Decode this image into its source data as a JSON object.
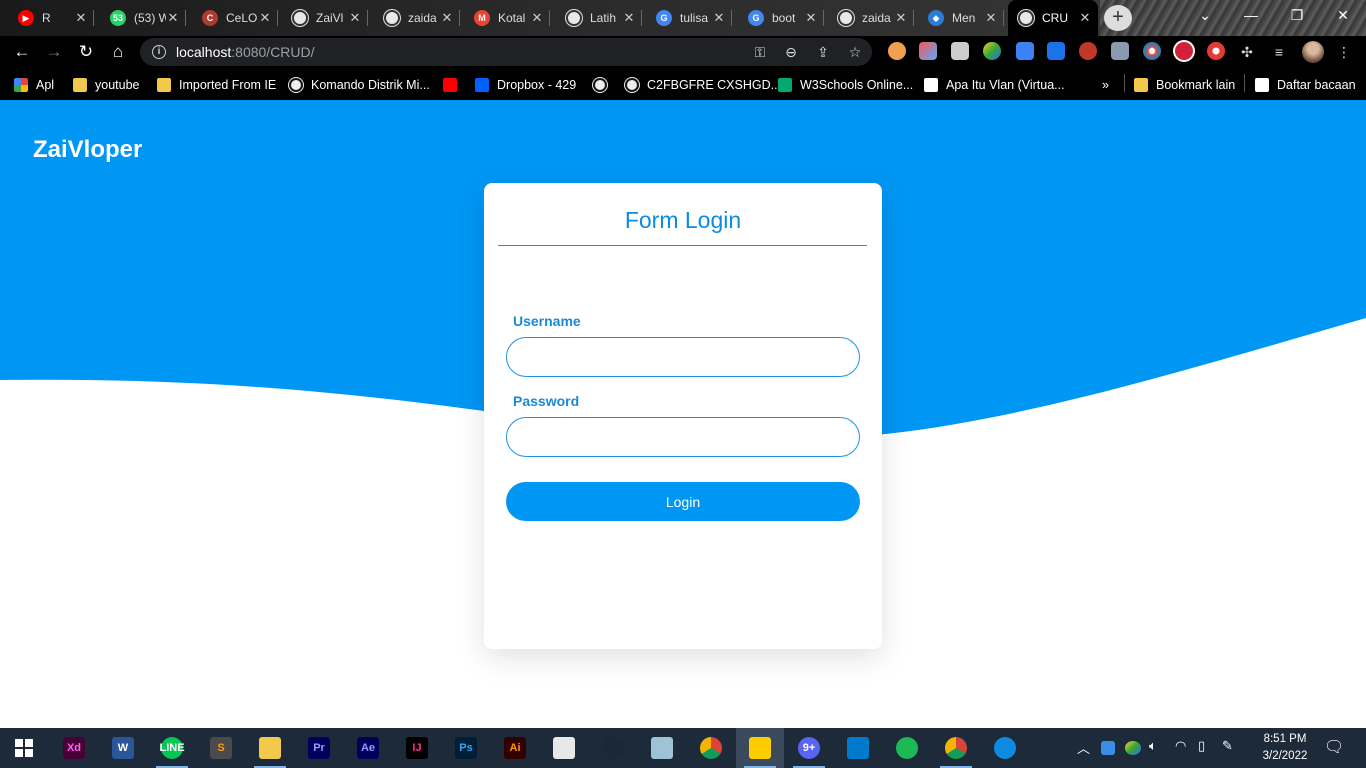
{
  "browser": {
    "tabs": [
      {
        "title": "R",
        "icon": "youtube-icon",
        "color": "#ff0000",
        "glyph": "▶"
      },
      {
        "title": "(53) W",
        "icon": "whatsapp-icon",
        "color": "#25d366",
        "glyph": "53"
      },
      {
        "title": "CeLO",
        "icon": "celo-icon",
        "color": "#b03a2e",
        "glyph": "C"
      },
      {
        "title": "ZaiVl",
        "icon": "globe-icon",
        "color": "#e8e8e8",
        "glyph": ""
      },
      {
        "title": "zaida",
        "icon": "github-icon",
        "color": "#e8e8e8",
        "glyph": ""
      },
      {
        "title": "Kotal",
        "icon": "gmail-icon",
        "color": "#ea4335",
        "glyph": "M"
      },
      {
        "title": "Latih",
        "icon": "globe-icon",
        "color": "#e8e8e8",
        "glyph": ""
      },
      {
        "title": "tulisa",
        "icon": "google-icon",
        "color": "#4285f4",
        "glyph": "G"
      },
      {
        "title": "boot",
        "icon": "google-icon",
        "color": "#4285f4",
        "glyph": "G"
      },
      {
        "title": "zaida",
        "icon": "github-icon",
        "color": "#e8e8e8",
        "glyph": ""
      },
      {
        "title": "Men",
        "icon": "diamond-icon",
        "color": "#2b7cd3",
        "glyph": "◆"
      },
      {
        "title": "CRU",
        "icon": "globe-icon",
        "color": "#e8e8e8",
        "glyph": ""
      }
    ],
    "new_tab": "+",
    "address": {
      "host": "localhost",
      "path": ":8080/CRUD/"
    },
    "bookmarks": [
      {
        "label": "Apl",
        "icon": "apps-grid-icon",
        "color": "#4a90d9"
      },
      {
        "label": "youtube",
        "icon": "folder-icon",
        "color": "#f2c94c"
      },
      {
        "label": "Imported From IE",
        "icon": "folder-icon",
        "color": "#f2c94c"
      },
      {
        "label": "Komando Distrik Mi...",
        "icon": "globe-icon",
        "color": "#eeeeee"
      },
      {
        "label": "",
        "icon": "youtube-icon",
        "color": "#ff0000"
      },
      {
        "label": "Dropbox - 429",
        "icon": "dropbox-icon",
        "color": "#0061fe"
      },
      {
        "label": "",
        "icon": "globe-icon",
        "color": "#eeeeee"
      },
      {
        "label": "C2FBGFRE CXSHGD...",
        "icon": "globe-icon",
        "color": "#eeeeee"
      },
      {
        "label": "W3Schools Online...",
        "icon": "w3schools-icon",
        "color": "#04aa6d"
      },
      {
        "label": "Apa Itu Vlan (Virtua...",
        "icon": "wordpress-icon",
        "color": "#ffffff"
      },
      {
        "label": "»",
        "icon": "",
        "color": ""
      },
      {
        "label": "Bookmark lain",
        "icon": "folder-icon",
        "color": "#f2c94c"
      },
      {
        "label": "Daftar bacaan",
        "icon": "reading-list-icon",
        "color": "#ffffff"
      }
    ]
  },
  "page": {
    "brand": "ZaiVloper",
    "colors": {
      "primary": "#0096f4",
      "title": "#0c8ce0"
    },
    "form": {
      "title": "Form Login",
      "username_label": "Username",
      "username_value": "",
      "password_label": "Password",
      "password_value": "",
      "submit_label": "Login"
    }
  },
  "taskbar": {
    "apps": [
      {
        "name": "Xd",
        "icon": "adobe-xd-icon",
        "color": "#470137",
        "fg": "#ff61f6",
        "running": false
      },
      {
        "name": "W",
        "icon": "word-icon",
        "color": "#2b579a",
        "fg": "#ffffff",
        "running": false
      },
      {
        "name": "LINE",
        "icon": "line-icon",
        "color": "#06c755",
        "fg": "#ffffff",
        "running": true
      },
      {
        "name": "S",
        "icon": "sublime-icon",
        "color": "#4b4b4b",
        "fg": "#ff9800",
        "running": false
      },
      {
        "name": "",
        "icon": "file-explorer-icon",
        "color": "#f2c94c",
        "fg": "#ffffff",
        "running": true
      },
      {
        "name": "Pr",
        "icon": "premiere-icon",
        "color": "#00005b",
        "fg": "#9999ff",
        "running": false
      },
      {
        "name": "Ae",
        "icon": "after-effects-icon",
        "color": "#00005b",
        "fg": "#9999ff",
        "running": false
      },
      {
        "name": "IJ",
        "icon": "intellij-icon",
        "color": "#000000",
        "fg": "#ff318c",
        "running": false
      },
      {
        "name": "Ps",
        "icon": "photoshop-icon",
        "color": "#001e36",
        "fg": "#31a8ff",
        "running": false
      },
      {
        "name": "Ai",
        "icon": "illustrator-icon",
        "color": "#330000",
        "fg": "#ff9a00",
        "running": false
      },
      {
        "name": "",
        "icon": "spreadsheet-icon",
        "color": "#e8e8e8",
        "fg": "#2e7d32",
        "running": false
      },
      {
        "name": "",
        "icon": "steam-icon",
        "color": "#1b2838",
        "fg": "#ffffff",
        "running": false
      },
      {
        "name": "",
        "icon": "notepad-icon",
        "color": "#9ec3d6",
        "fg": "#ffffff",
        "running": false
      },
      {
        "name": "",
        "icon": "chrome-icon",
        "color": "#db4437",
        "fg": "#ffffff",
        "running": false
      },
      {
        "name": "",
        "icon": "sticky-notes-icon",
        "color": "#ffcc00",
        "fg": "#000000",
        "running": true
      },
      {
        "name": "9+",
        "icon": "discord-icon",
        "color": "#5865f2",
        "fg": "#ffffff",
        "running": true
      },
      {
        "name": "",
        "icon": "vscode-icon",
        "color": "#007acc",
        "fg": "#ffffff",
        "running": false
      },
      {
        "name": "",
        "icon": "spotify-icon",
        "color": "#1db954",
        "fg": "#000000",
        "running": false
      },
      {
        "name": "",
        "icon": "chrome-icon",
        "color": "#db4437",
        "fg": "#ffffff",
        "running": true
      },
      {
        "name": "",
        "icon": "edge-icon",
        "color": "#0c8ce0",
        "fg": "#ffffff",
        "running": false
      }
    ],
    "time": "8:51 PM",
    "date": "3/2/2022"
  }
}
